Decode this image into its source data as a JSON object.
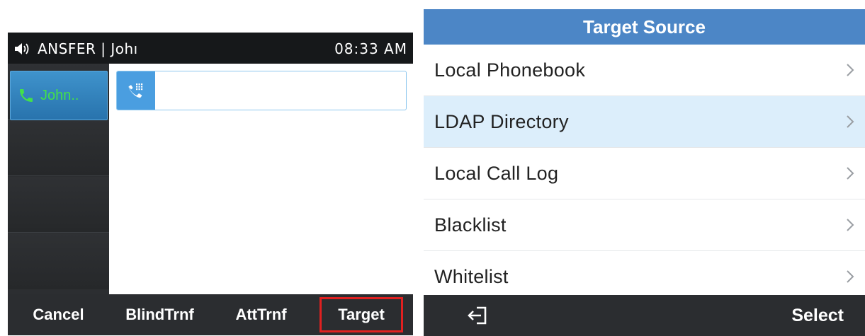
{
  "left_screen": {
    "status": {
      "speaker_icon": "speaker-volume-icon",
      "caller_text": "ANSFER | Johı",
      "time": "08:33 AM"
    },
    "line_key": {
      "icon": "phone-handset-icon",
      "label": "John..",
      "label_color": "#43e04a"
    },
    "dial_field": {
      "icon": "dialpad-phone-icon",
      "value": ""
    },
    "softkeys": [
      {
        "label": "Cancel"
      },
      {
        "label": "BlindTrnf"
      },
      {
        "label": "AttTrnf"
      },
      {
        "label": "Target",
        "highlighted": true
      }
    ]
  },
  "right_screen": {
    "title": "Target Source",
    "title_bar_color": "#4c86c6",
    "items": [
      {
        "label": "Local Phonebook",
        "selected": false
      },
      {
        "label": "LDAP Directory",
        "selected": true
      },
      {
        "label": "Local Call Log",
        "selected": false
      },
      {
        "label": "Blacklist",
        "selected": false
      },
      {
        "label": "Whitelist",
        "selected": false
      }
    ],
    "bottom_bar": {
      "exit_icon": "exit-icon",
      "select_label": "Select"
    }
  },
  "colors": {
    "highlight_outline": "#e02020",
    "selected_row": "#dceefb"
  }
}
